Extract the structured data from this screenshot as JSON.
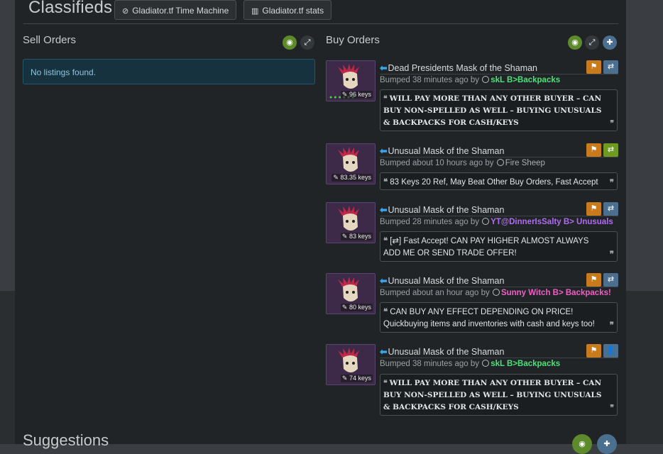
{
  "header": {
    "title": "Classifieds",
    "time_machine_label": "Gladiator.tf Time Machine",
    "stats_label": "Gladiator.tf stats"
  },
  "sell": {
    "title": "Sell Orders",
    "empty": "No listings found."
  },
  "buy": {
    "title": "Buy Orders",
    "listings": [
      {
        "name": "Dead Presidents Mask of the Shaman",
        "bumped": "Bumped 38 minutes ago by",
        "user": "skL B>Backpacks",
        "user_color": "#4de07a",
        "price": "96 keys",
        "comment": "WILL PAY MORE THAN ANY OTHER BUYER   –   CAN BUY NON-SPELLED AS WELL    –    BUYING UNUSUALS & BACKPACKS FOR CASH/KEYS",
        "action": "trade-icon"
      },
      {
        "name": "Unusual Mask of the Shaman",
        "bumped": "Bumped about 10 hours ago by",
        "user": "Fire Sheep",
        "user_color": "#a8adb1",
        "price": "83.35 keys",
        "comment": "83 Keys 20 Ref, May Beat Other Buy Orders, Fast Accept",
        "action": "trade-icon"
      },
      {
        "name": "Unusual Mask of the Shaman",
        "bumped": "Bumped 28 minutes ago by",
        "user": "YT@DinnerIsSalty B> Unusuals",
        "user_color": "#b06cf0",
        "price": "83 keys",
        "comment": "[⇄] Fast Accept! CAN PAY HIGHER ALMOST ALWAYS ADD ME OR SEND TRADE OFFER!",
        "action": "trade-icon"
      },
      {
        "name": "Unusual Mask of the Shaman",
        "bumped": "Bumped about an hour ago by",
        "user": "Sunny Witch B> Backpacks!",
        "user_color": "#f05fc6",
        "price": "80 keys",
        "comment": "CAN BUY ANY EFFECT DEPENDING ON PRICE! Quickbuying items and inventories with cash and keys too!",
        "action": "trade-icon"
      },
      {
        "name": "Unusual Mask of the Shaman",
        "bumped": "Bumped 38 minutes ago by",
        "user": "skL B>Backpacks",
        "user_color": "#4de07a",
        "price": "74 keys",
        "comment": "WILL PAY MORE THAN ANY OTHER BUYER   –   CAN BUY NON-SPELLED AS WELL    –    BUYING UNUSUALS & BACKPACKS FOR CASH/KEYS",
        "action": "add-friend-icon"
      }
    ]
  },
  "suggestions": {
    "title": "Suggestions"
  },
  "icons": [
    "clock-icon",
    "bar-chart-icon",
    "eye-icon",
    "expand-icon",
    "plus-icon",
    "flag-icon",
    "trade-icon",
    "add-friend-icon",
    "tag-icon",
    "quote-icon"
  ]
}
